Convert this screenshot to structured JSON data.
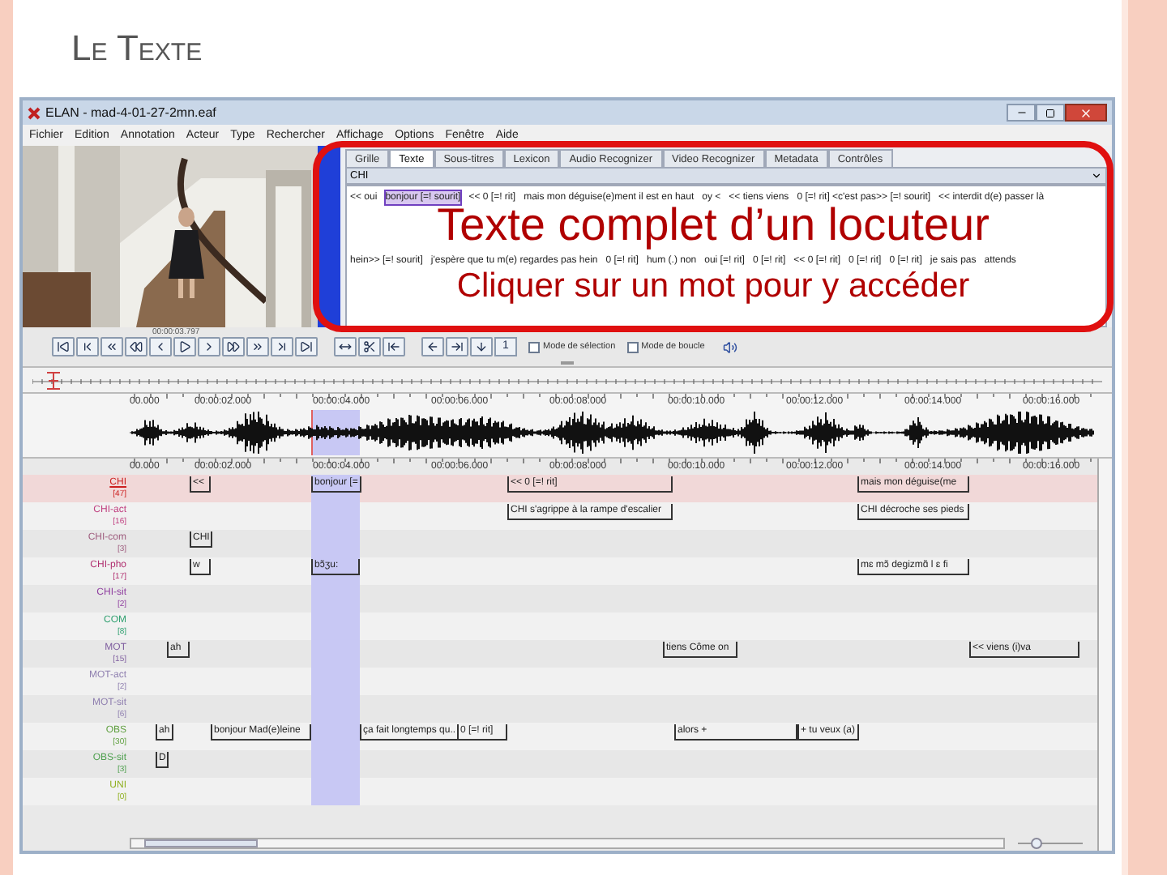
{
  "slide": {
    "title": "Le Texte"
  },
  "window": {
    "title": "ELAN - mad-4-01-27-2mn.eaf"
  },
  "menu": [
    "Fichier",
    "Edition",
    "Annotation",
    "Acteur",
    "Type",
    "Rechercher",
    "Affichage",
    "Options",
    "Fenêtre",
    "Aide"
  ],
  "player": {
    "time": "00:00:03.797"
  },
  "tabs": [
    {
      "label": "Grille",
      "selected": false
    },
    {
      "label": "Texte",
      "selected": true
    },
    {
      "label": "Sous-titres",
      "selected": false
    },
    {
      "label": "Lexicon",
      "selected": false
    },
    {
      "label": "Audio Recognizer",
      "selected": false
    },
    {
      "label": "Video Recognizer",
      "selected": false
    },
    {
      "label": "Metadata",
      "selected": false
    },
    {
      "label": "Contrôles",
      "selected": false
    }
  ],
  "tier_select": {
    "value": "CHI"
  },
  "text_lines": [
    {
      "segments": [
        {
          "text": "<< oui",
          "selected": false
        },
        {
          "text": "bonjour [=! sourit]",
          "selected": true
        },
        {
          "text": "<< 0 [=! rit]",
          "selected": false
        },
        {
          "text": "mais mon déguise(e)ment il est en haut",
          "selected": false
        },
        {
          "text": "oy <",
          "selected": false
        },
        {
          "text": "<< tiens viens",
          "selected": false
        },
        {
          "text": "0 [=! rit] <c'est pas>> [=! sourit]",
          "selected": false
        },
        {
          "text": "<< interdit d(e) passer là",
          "selected": false
        }
      ]
    },
    {
      "segments": [
        {
          "text": "hein>> [=! sourit]",
          "selected": false
        },
        {
          "text": "j'espère que tu m(e) regardes pas hein",
          "selected": false
        },
        {
          "text": "0 [=! rit]",
          "selected": false
        },
        {
          "text": "hum (.) non",
          "selected": false
        },
        {
          "text": "oui [=! rit]",
          "selected": false
        },
        {
          "text": "0 [=! rit]",
          "selected": false
        },
        {
          "text": "<< 0 [=! rit]",
          "selected": false
        },
        {
          "text": "0 [=! rit]",
          "selected": false
        },
        {
          "text": "0 [=! rit]",
          "selected": false
        },
        {
          "text": "je sais pas",
          "selected": false
        },
        {
          "text": "attends",
          "selected": false
        }
      ]
    }
  ],
  "callout": {
    "title": "Texte complet d’un locuteur",
    "subtitle": "Cliquer sur un mot pour y accéder"
  },
  "controls": {
    "goto_label": "1",
    "checkboxes": [
      {
        "label": "Mode de sélection",
        "checked": false
      },
      {
        "label": "Mode de boucle",
        "checked": false
      }
    ]
  },
  "waveform_ruler": [
    "00.000",
    "00:00:02.000",
    "00:00:04.000",
    "00:00:06.000",
    "00:00:08.000",
    "00:00:10.000",
    "00:00:12.000",
    "00:00:14.000",
    "00:00:16.000"
  ],
  "tier_ruler": [
    "00.000",
    "00:00:02.000",
    "00:00:04.000",
    "00:00:06.000",
    "00:00:08.000",
    "00:00:10.000",
    "00:00:12.000",
    "00:00:14.000",
    "00:00:16.000"
  ],
  "tiers": [
    {
      "name": "CHI",
      "count": "[47]",
      "color": "#cc2020",
      "selected": true,
      "annotations": [
        {
          "text": "<<"
        },
        {
          "text": "bonjour [="
        },
        {
          "text": "<< 0 [=! rit]"
        },
        {
          "text": "mais mon déguise(me"
        }
      ]
    },
    {
      "name": "CHI-act",
      "count": "[16]",
      "color": "#c04080",
      "selected": false,
      "annotations": [
        {
          "text": "CHI s'agrippe à la rampe d'escalier"
        },
        {
          "text": "CHI décroche ses pieds"
        }
      ]
    },
    {
      "name": "CHI-com",
      "count": "[3]",
      "color": "#a06080",
      "selected": false,
      "annotations": [
        {
          "text": "CHI"
        }
      ]
    },
    {
      "name": "CHI-pho",
      "count": "[17]",
      "color": "#b03070",
      "selected": false,
      "annotations": [
        {
          "text": "w"
        },
        {
          "text": "bɔ̃ʒu:"
        },
        {
          "text": "mɛ mɔ̃ degizmɑ̃ l ɛ fi"
        }
      ]
    },
    {
      "name": "CHI-sit",
      "count": "[2]",
      "color": "#9040a0",
      "selected": false
    },
    {
      "name": "COM",
      "count": "[8]",
      "color": "#30a070",
      "selected": false
    },
    {
      "name": "MOT",
      "count": "[15]",
      "color": "#8060a0",
      "selected": false,
      "annotations": [
        {
          "text": "ah"
        },
        {
          "text": "tiens Côme on"
        },
        {
          "text": "<< viens (i)va"
        }
      ]
    },
    {
      "name": "MOT-act",
      "count": "[2]",
      "color": "#9080b0",
      "selected": false
    },
    {
      "name": "MOT-sit",
      "count": "[6]",
      "color": "#9080b0",
      "selected": false
    },
    {
      "name": "OBS",
      "count": "[30]",
      "color": "#60a040",
      "selected": false,
      "annotations": [
        {
          "text": "ah"
        },
        {
          "text": "bonjour Mad(e)leine"
        },
        {
          "text": "ça fait longtemps qu.."
        },
        {
          "text": "0 [=! rit]"
        },
        {
          "text": "alors +"
        },
        {
          "text": "+ tu veux (a)"
        }
      ]
    },
    {
      "name": "OBS-sit",
      "count": "[3]",
      "color": "#50a050",
      "selected": false,
      "annotations": [
        {
          "text": "D"
        }
      ]
    },
    {
      "name": "UNI",
      "count": "[0]",
      "color": "#90b020",
      "selected": false
    }
  ],
  "zoom_slider": {
    "level": 0.25
  }
}
